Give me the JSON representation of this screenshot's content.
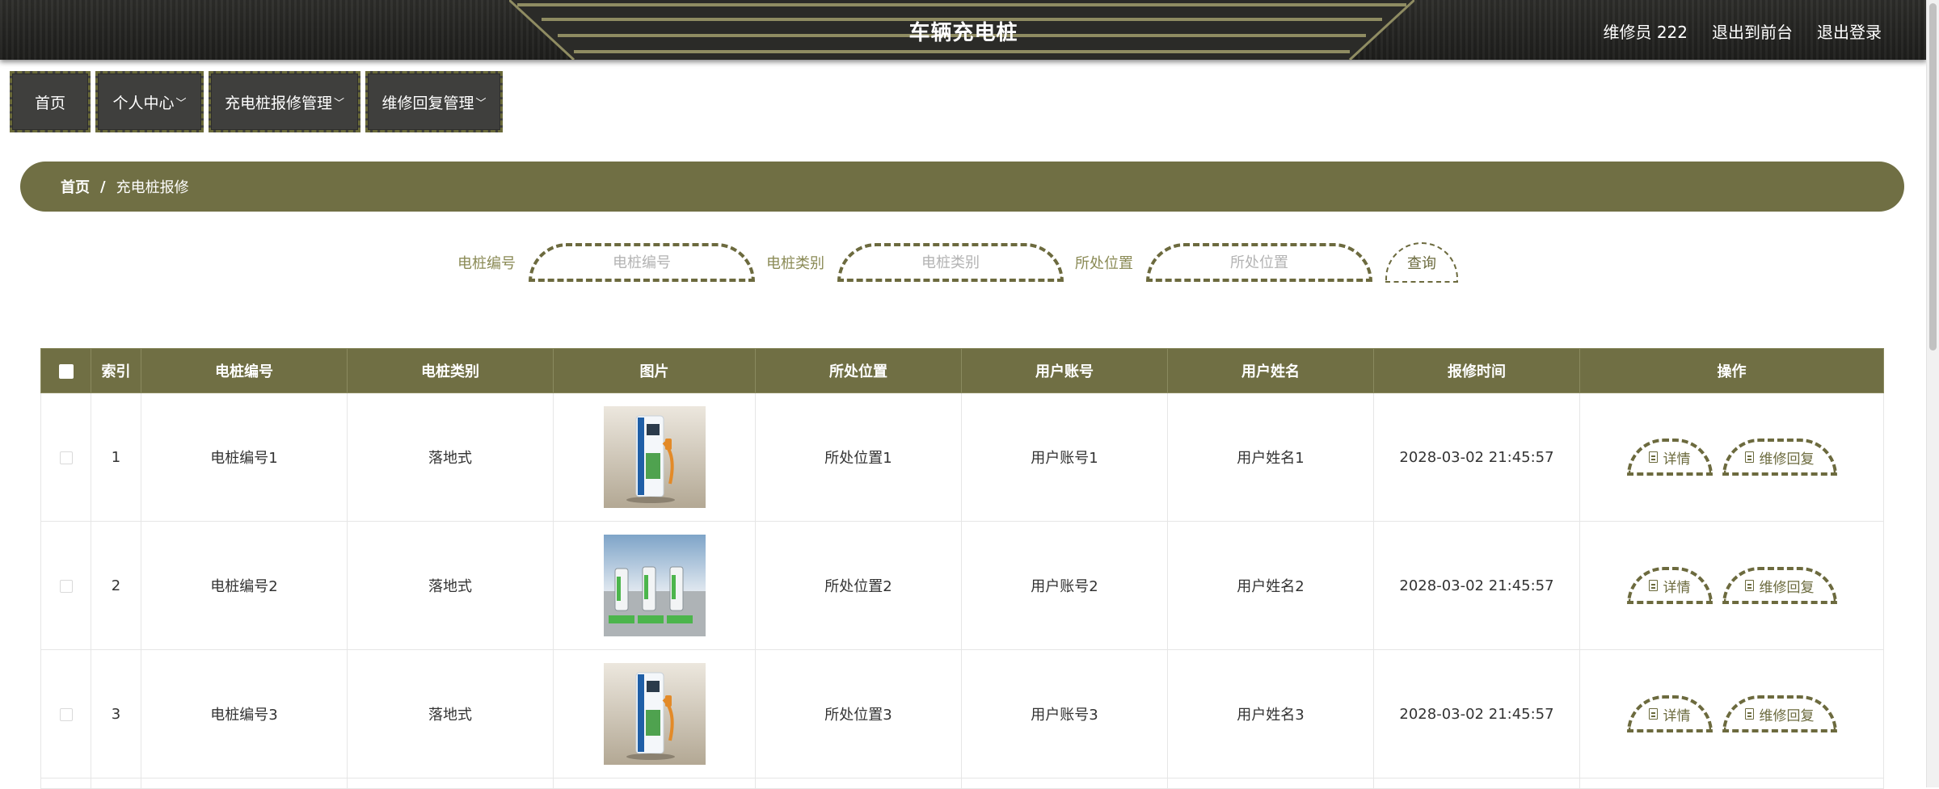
{
  "header": {
    "title": "车辆充电桩",
    "user_label": "维修员 222",
    "to_front": "退出到前台",
    "logout": "退出登录"
  },
  "nav": {
    "items": [
      {
        "label": "首页",
        "has_dropdown": false
      },
      {
        "label": "个人中心",
        "has_dropdown": true
      },
      {
        "label": "充电桩报修管理",
        "has_dropdown": true
      },
      {
        "label": "维修回复管理",
        "has_dropdown": true
      }
    ]
  },
  "breadcrumb": {
    "home": "首页",
    "separator": "/",
    "current": "充电桩报修"
  },
  "search": {
    "pile_no_label": "电桩编号",
    "pile_no_placeholder": "电桩编号",
    "pile_type_label": "电桩类别",
    "pile_type_placeholder": "电桩类别",
    "location_label": "所处位置",
    "location_placeholder": "所处位置",
    "query_button": "查询"
  },
  "table": {
    "headers": [
      "索引",
      "电桩编号",
      "电桩类别",
      "图片",
      "所处位置",
      "用户账号",
      "用户姓名",
      "报修时间",
      "操作"
    ],
    "detail_label": "详情",
    "reply_label": "维修回复",
    "rows": [
      {
        "index": "1",
        "pile_no": "电桩编号1",
        "pile_type": "落地式",
        "image": "single-charger-photo",
        "location": "所处位置1",
        "account": "用户账号1",
        "name": "用户姓名1",
        "time": "2028-03-02 21:45:57"
      },
      {
        "index": "2",
        "pile_no": "电桩编号2",
        "pile_type": "落地式",
        "image": "charging-station-row-photo",
        "location": "所处位置2",
        "account": "用户账号2",
        "name": "用户姓名2",
        "time": "2028-03-02 21:45:57"
      },
      {
        "index": "3",
        "pile_no": "电桩编号3",
        "pile_type": "落地式",
        "image": "single-charger-photo",
        "location": "所处位置3",
        "account": "用户账号3",
        "name": "用户姓名3",
        "time": "2028-03-02 21:45:57"
      }
    ]
  },
  "colors": {
    "accent": "#706f44",
    "header_bg": "#262624",
    "nav_bg": "#3f3f3d",
    "dashed_border": "#6c6a3e"
  }
}
